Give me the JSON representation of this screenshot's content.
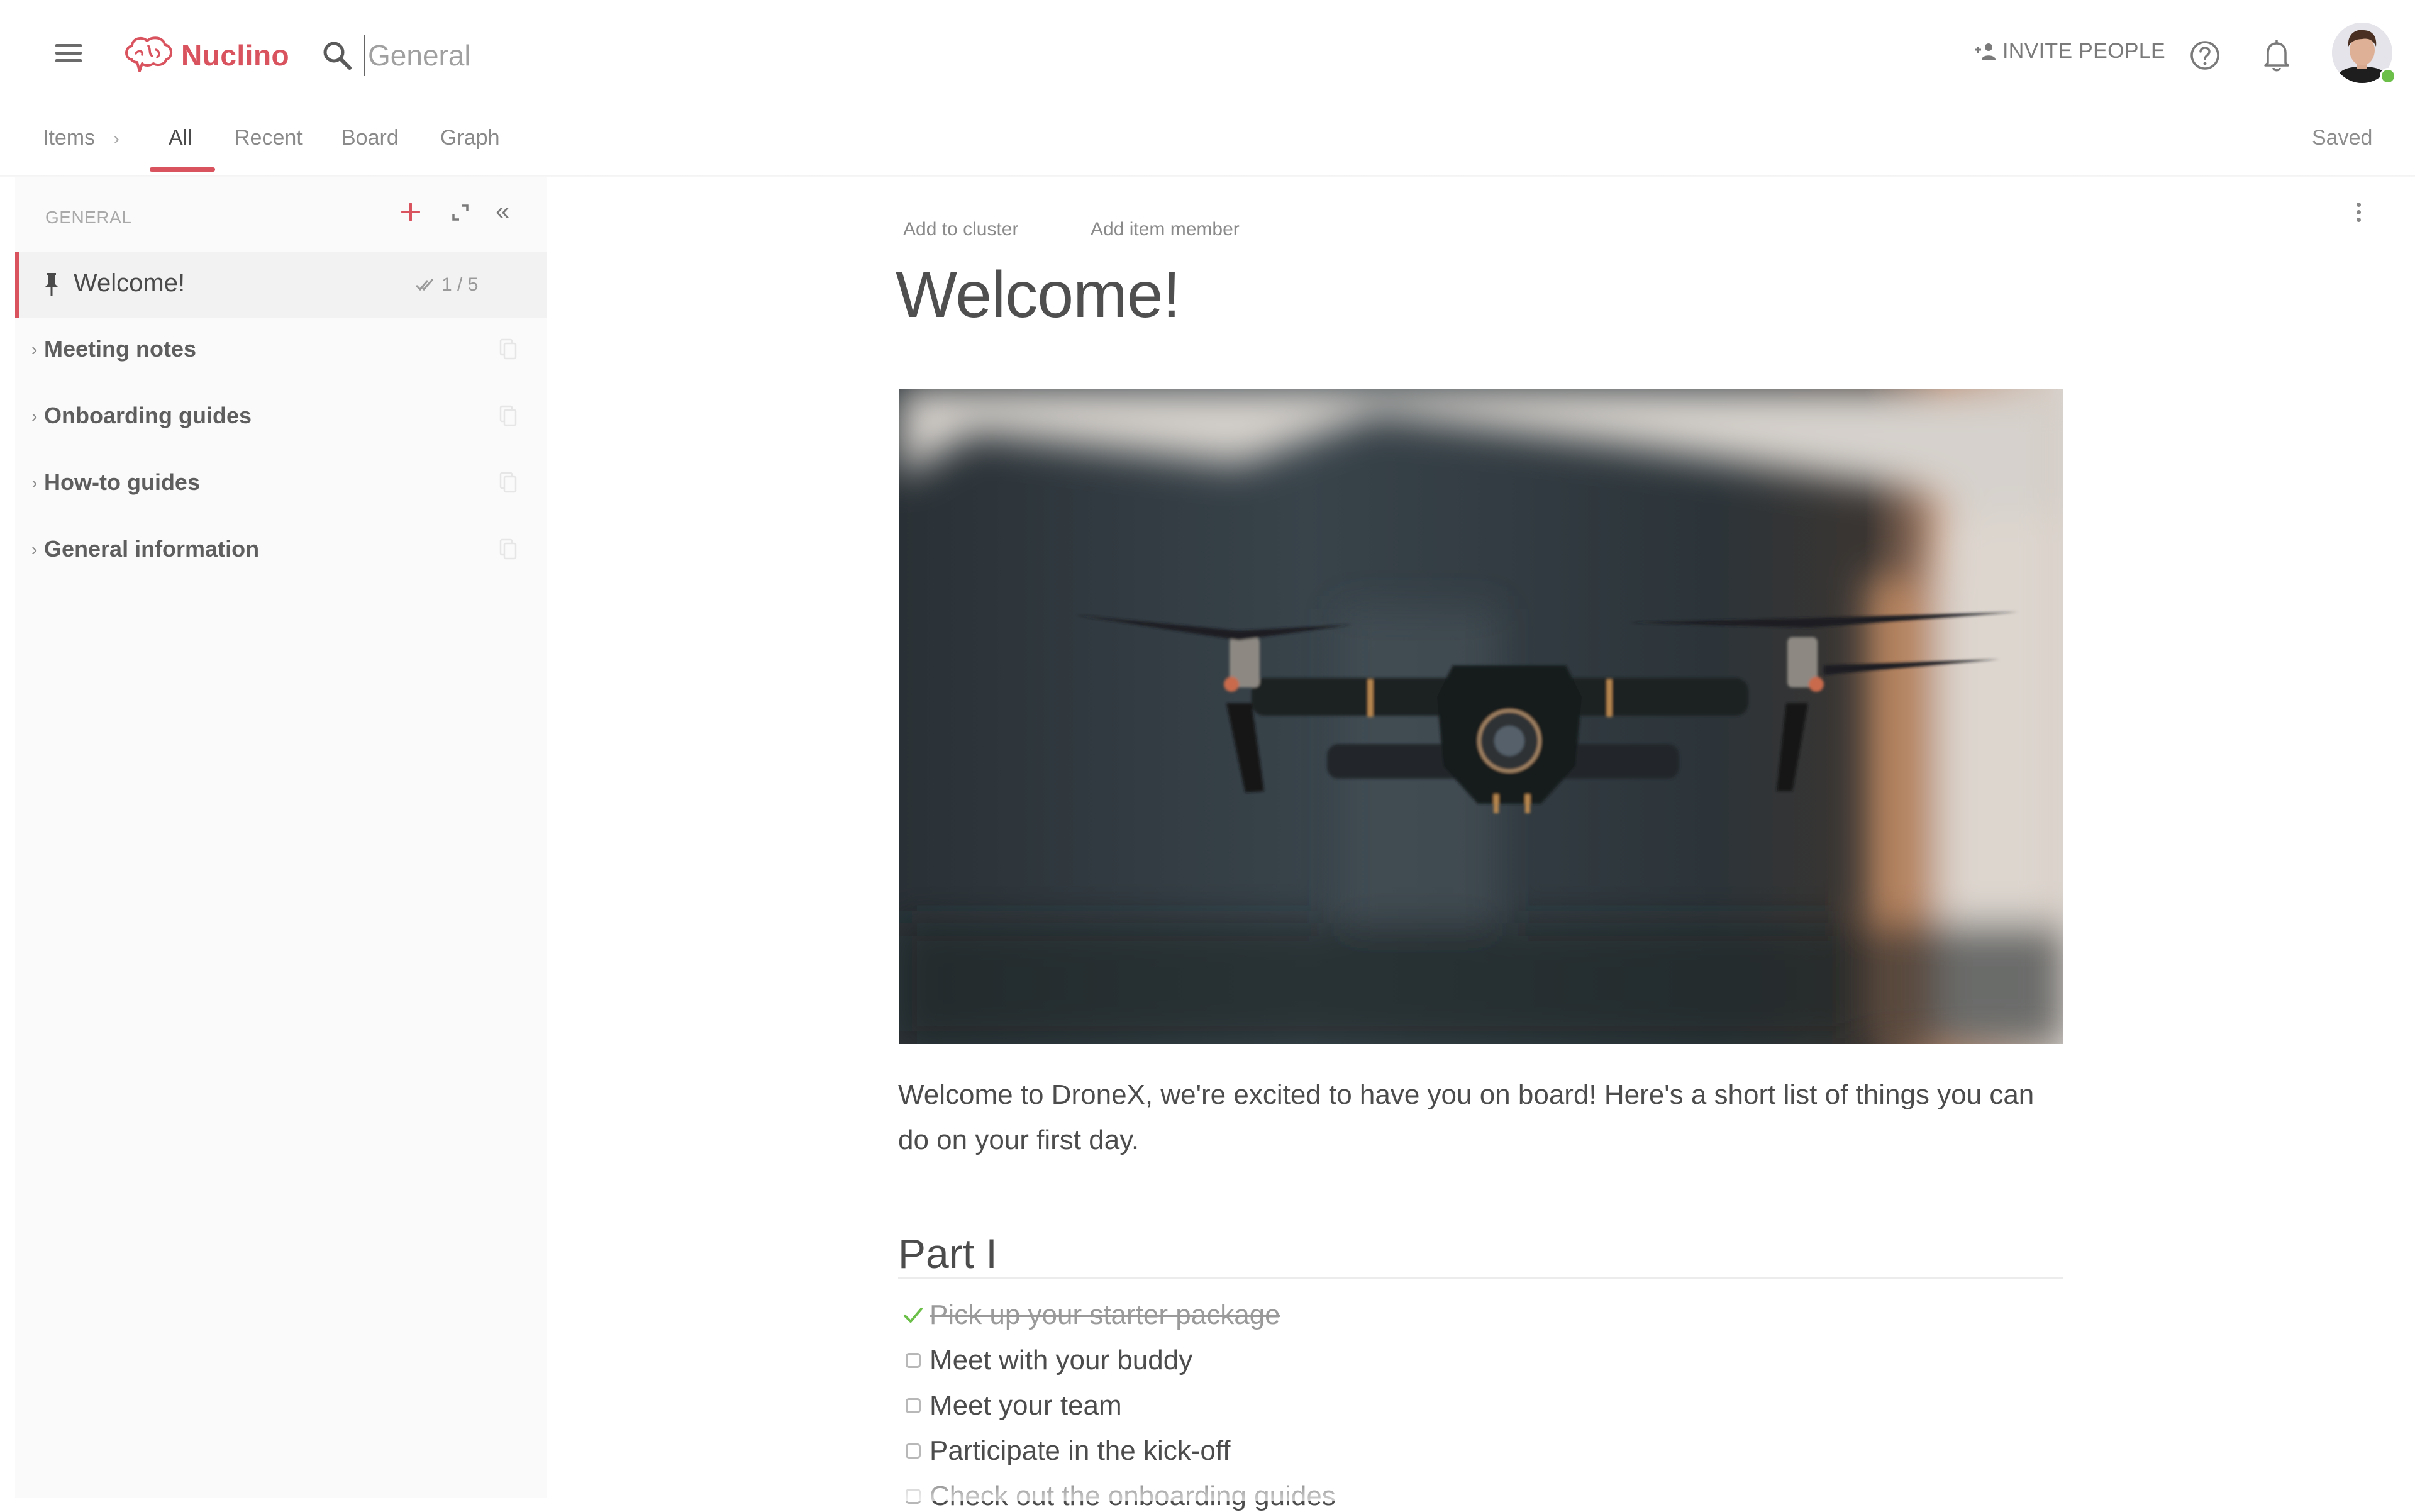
{
  "app": {
    "name": "Nuclino",
    "brand_color": "#d9535f"
  },
  "header": {
    "menu_icon": "hamburger-menu-icon",
    "search": {
      "icon": "search-icon",
      "value": "",
      "placeholder": "General"
    },
    "invite_label": "INVITE PEOPLE",
    "invite_icon": "add-person-icon",
    "help_icon": "question-circle-icon",
    "notifications_icon": "bell-icon",
    "user_status": "online",
    "status_color": "#6cc04a"
  },
  "tabs": {
    "breadcrumb": "Items",
    "items": [
      {
        "label": "All",
        "active": true
      },
      {
        "label": "Recent",
        "active": false
      },
      {
        "label": "Board",
        "active": false
      },
      {
        "label": "Graph",
        "active": false
      }
    ],
    "save_status": "Saved"
  },
  "sidebar": {
    "section_label": "GENERAL",
    "add_icon": "plus-icon",
    "expand_icon": "expand-icon",
    "collapse_icon": "double-chevron-left-icon",
    "active_item": {
      "label": "Welcome!",
      "pinned": true,
      "progress": "1 / 5",
      "tasks_done": 1,
      "tasks_total": 5
    },
    "items": [
      {
        "label": "Meeting notes"
      },
      {
        "label": "Onboarding guides"
      },
      {
        "label": "How-to guides"
      },
      {
        "label": "General information"
      }
    ]
  },
  "document": {
    "actions": {
      "add_to_cluster": "Add to cluster",
      "add_item_member": "Add item member"
    },
    "more_icon": "vertical-ellipsis-icon",
    "title": "Welcome!",
    "hero_image": "drone-photo",
    "intro": "Welcome to DroneX, we're excited to have you on board! Here's a short list of things you can do on your first day.",
    "section_heading": "Part I",
    "checklist": [
      {
        "label": "Pick up your starter package",
        "done": true
      },
      {
        "label": "Meet with your buddy",
        "done": false
      },
      {
        "label": "Meet your team",
        "done": false
      },
      {
        "label": "Participate in the kick-off",
        "done": false
      },
      {
        "label": "Check out the onboarding guides",
        "done": false
      }
    ]
  }
}
